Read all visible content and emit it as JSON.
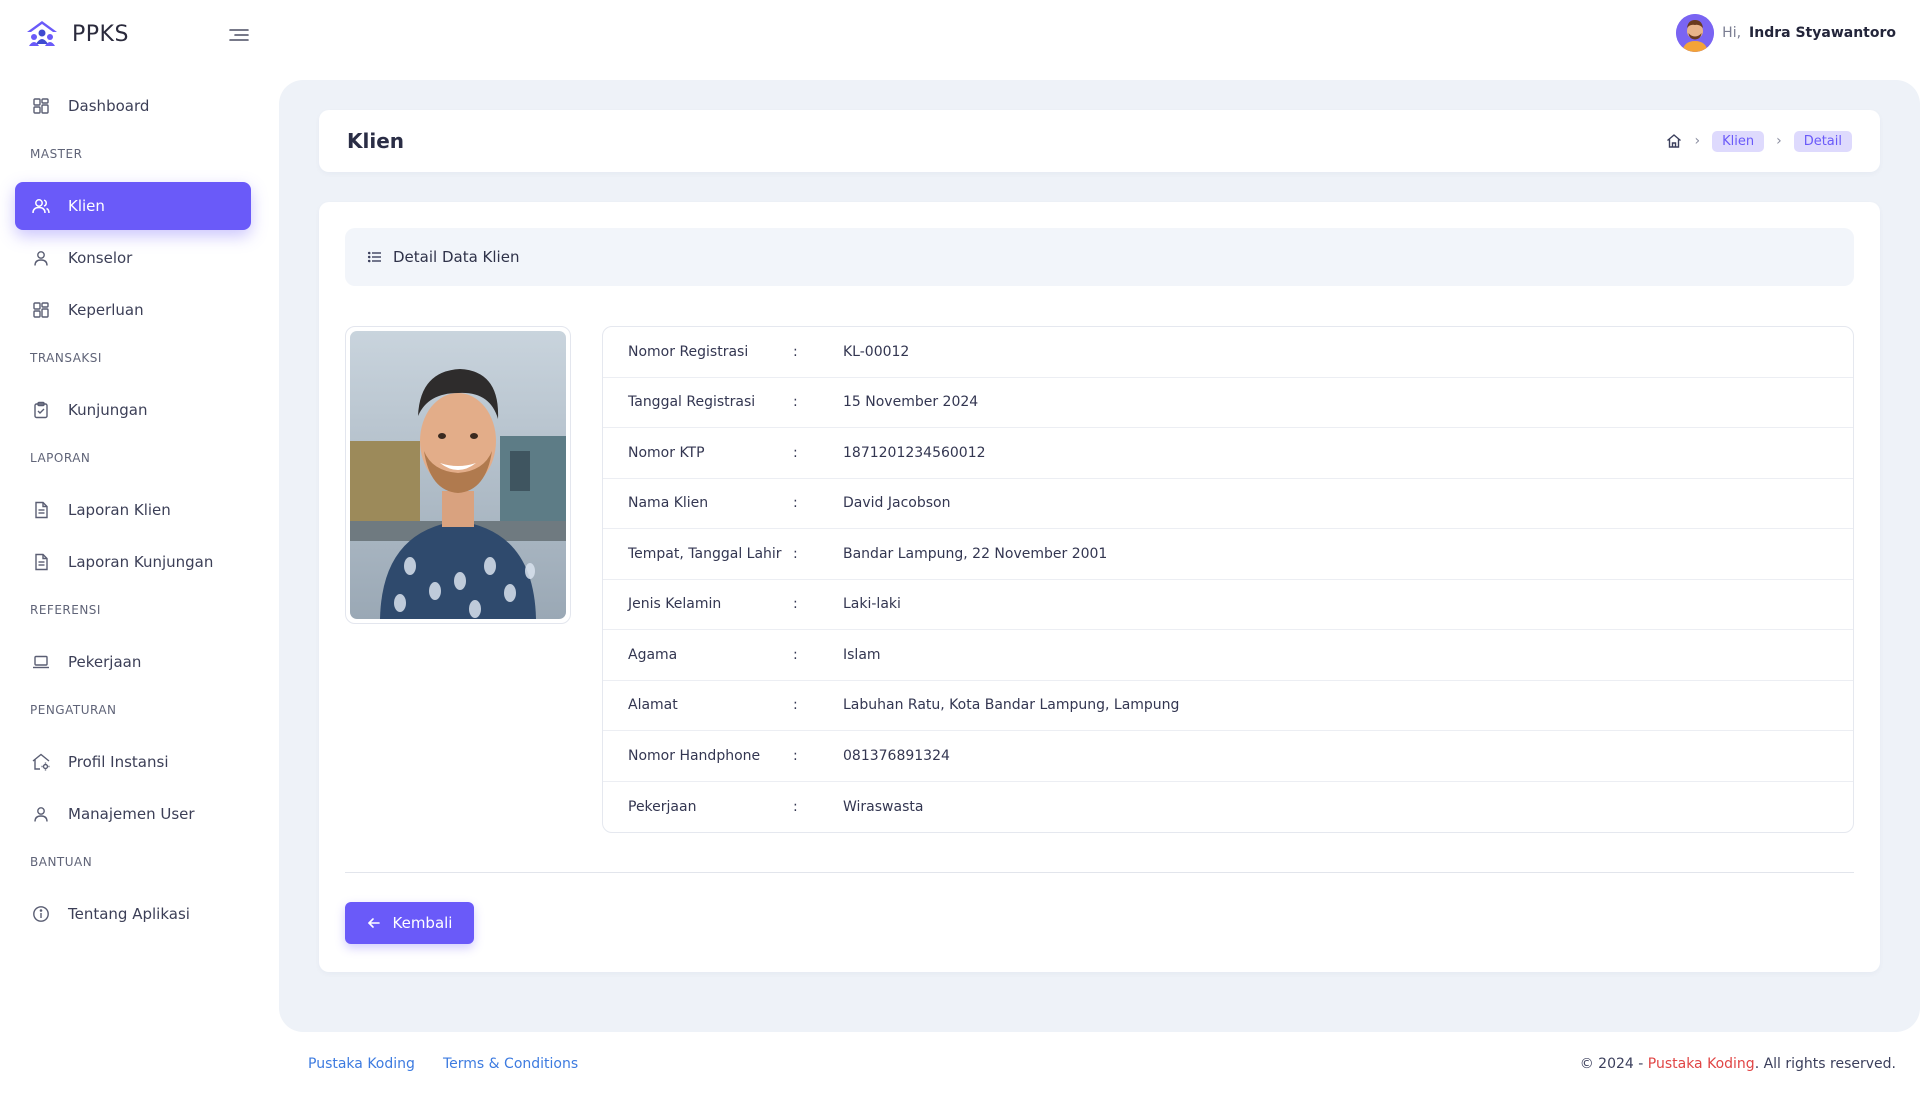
{
  "app": {
    "name": "PPKS"
  },
  "user": {
    "greeting": "Hi,",
    "name": "Indra Styawantoro"
  },
  "sidebar": {
    "dashboard": "Dashboard",
    "section_master": "MASTER",
    "klien": "Klien",
    "konselor": "Konselor",
    "keperluan": "Keperluan",
    "section_transaksi": "TRANSAKSI",
    "kunjungan": "Kunjungan",
    "section_laporan": "LAPORAN",
    "laporan_klien": "Laporan Klien",
    "laporan_kunjungan": "Laporan Kunjungan",
    "section_referensi": "REFERENSI",
    "pekerjaan": "Pekerjaan",
    "section_pengaturan": "PENGATURAN",
    "profil_instansi": "Profil Instansi",
    "manajemen_user": "Manajemen User",
    "section_bantuan": "BANTUAN",
    "tentang_aplikasi": "Tentang Aplikasi"
  },
  "page": {
    "title": "Klien",
    "breadcrumb": [
      "Klien",
      "Detail"
    ],
    "card_title": "Detail Data Klien",
    "back_label": "Kembali"
  },
  "client": {
    "rows": [
      {
        "label": "Nomor Registrasi",
        "value": "KL-00012"
      },
      {
        "label": "Tanggal Registrasi",
        "value": "15 November 2024"
      },
      {
        "label": "Nomor KTP",
        "value": "1871201234560012"
      },
      {
        "label": "Nama Klien",
        "value": "David Jacobson"
      },
      {
        "label": "Tempat, Tanggal Lahir",
        "value": "Bandar Lampung, 22 November 2001"
      },
      {
        "label": "Jenis Kelamin",
        "value": "Laki-laki"
      },
      {
        "label": "Agama",
        "value": "Islam"
      },
      {
        "label": "Alamat",
        "value": "Labuhan Ratu, Kota Bandar Lampung, Lampung"
      },
      {
        "label": "Nomor Handphone",
        "value": "081376891324"
      },
      {
        "label": "Pekerjaan",
        "value": "Wiraswasta"
      }
    ],
    "separator": ":"
  },
  "footer": {
    "link1": "Pustaka Koding",
    "link2": "Terms & Conditions",
    "copyright_prefix": "© 2024 - ",
    "copyright_brand": "Pustaka Koding",
    "copyright_suffix": ". All rights reserved."
  },
  "colors": {
    "accent": "#6a5af9",
    "background": "#eef2f8",
    "link": "#3d7be0",
    "brand_red": "#e04545"
  }
}
